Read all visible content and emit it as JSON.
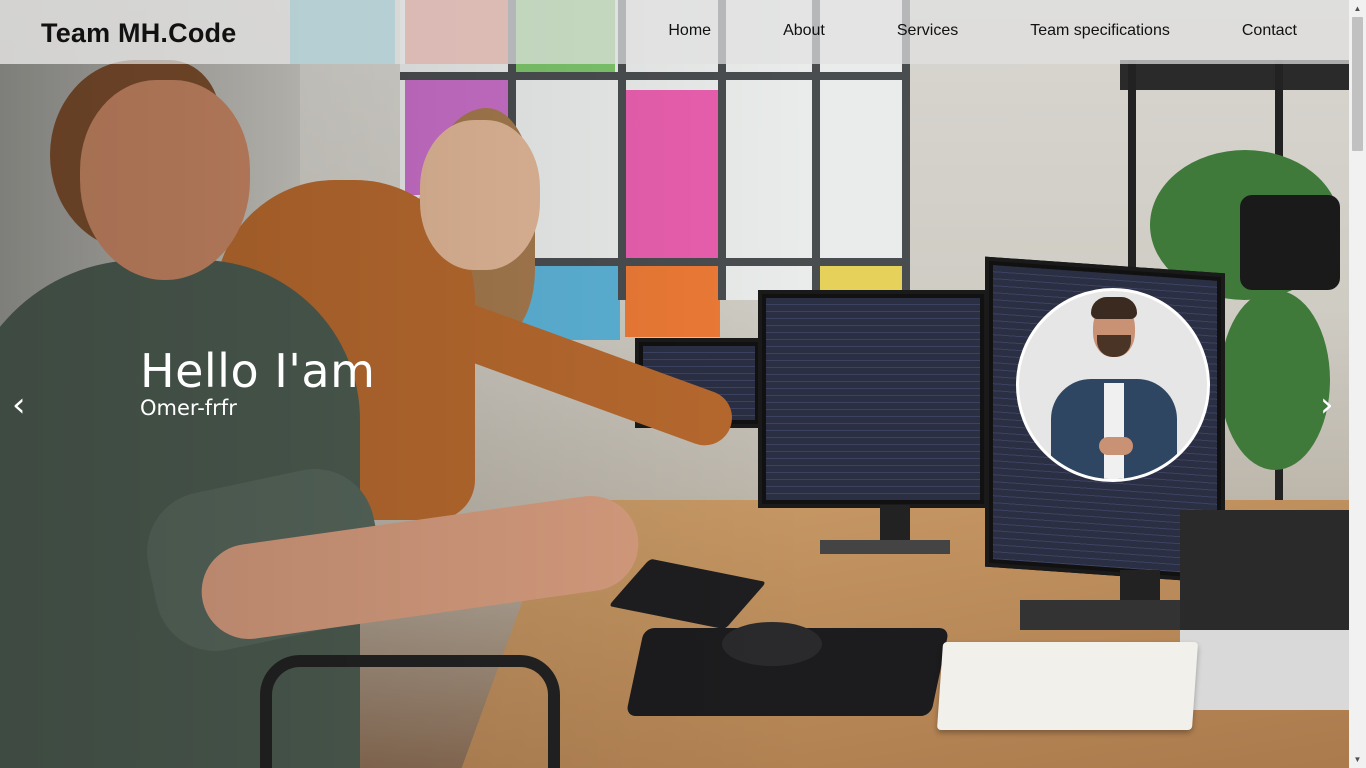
{
  "navbar": {
    "brand": "Team MH.Code",
    "links": [
      "Home",
      "About",
      "Services",
      "Team specifications",
      "Contact"
    ]
  },
  "hero": {
    "greeting": "Hello I'am",
    "name": "Omer-frfr",
    "prev_icon": "‹",
    "next_icon": "›",
    "icons": {
      "prev": "chevron-left-icon",
      "next": "chevron-right-icon"
    }
  },
  "scrollbar": {
    "up_icon": "▲",
    "down_icon": "▼"
  },
  "colors": {
    "navbar_bg": "#e1e1e1",
    "text_dark": "#111111",
    "text_light": "#ffffff",
    "avatar_border": "#ffffff"
  }
}
